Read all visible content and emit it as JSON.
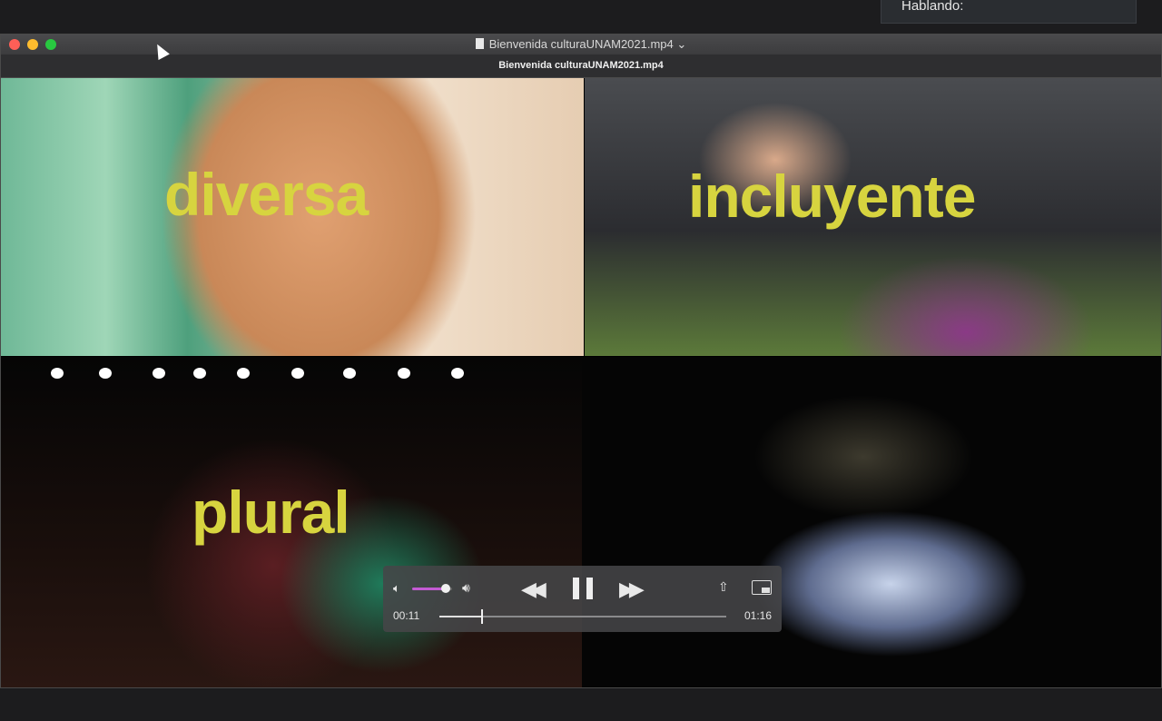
{
  "speaking_panel": {
    "label": "Hablando:"
  },
  "window": {
    "title": "Bienvenida culturaUNAM2021.mp4",
    "title_chevron": "⌄",
    "subtitle": "Bienvenida culturaUNAM2021.mp4"
  },
  "video": {
    "overlay_words": [
      "diversa",
      "incluyente",
      "plural"
    ]
  },
  "controls": {
    "volume_level": 0.85,
    "progress_fraction": 0.145,
    "current_time": "00:11",
    "duration": "01:16",
    "icons": {
      "volume_low": "speaker-low-icon",
      "volume_high": "speaker-high-icon",
      "rewind": "rewind-icon",
      "pause": "pause-icon",
      "fast_forward": "fast-forward-icon",
      "share": "share-icon",
      "pip": "picture-in-picture-icon"
    }
  },
  "colors": {
    "overlay_text": "#d7d43f",
    "volume_accent": "#c45bd4",
    "close": "#fe5f57",
    "minimize": "#febc2e",
    "zoom": "#28c840"
  }
}
